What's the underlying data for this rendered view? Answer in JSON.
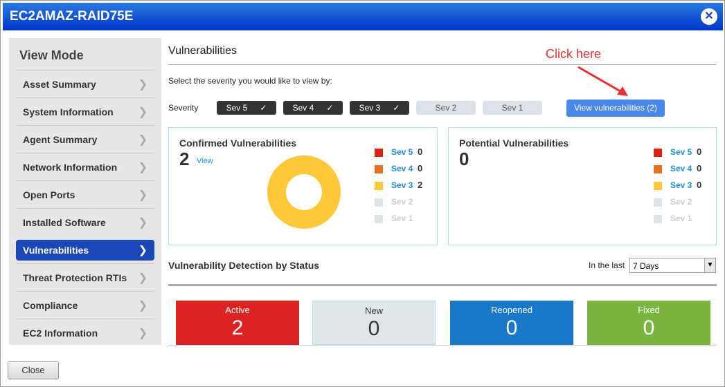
{
  "window": {
    "title": "EC2AMAZ-RAID75E",
    "close_icon": "close-icon"
  },
  "sidebar": {
    "title": "View Mode",
    "items": [
      {
        "label": "Asset Summary"
      },
      {
        "label": "System Information"
      },
      {
        "label": "Agent Summary"
      },
      {
        "label": "Network Information"
      },
      {
        "label": "Open Ports"
      },
      {
        "label": "Installed Software"
      },
      {
        "label": "Vulnerabilities",
        "active": true
      },
      {
        "label": "Threat Protection RTIs"
      },
      {
        "label": "Compliance"
      },
      {
        "label": "EC2 Information"
      }
    ]
  },
  "main": {
    "title": "Vulnerabilities",
    "prompt": "Select the severity you would like to view by:",
    "severity_label": "Severity",
    "severities": [
      {
        "label": "Sev 5",
        "selected": true
      },
      {
        "label": "Sev 4",
        "selected": true
      },
      {
        "label": "Sev 3",
        "selected": true
      },
      {
        "label": "Sev 2",
        "selected": false
      },
      {
        "label": "Sev 1",
        "selected": false
      }
    ],
    "view_button": "View vulnerabilities (2)",
    "annotation": "Click here",
    "confirmed": {
      "title": "Confirmed Vulnerabilities",
      "count": "2",
      "view_link": "View",
      "legend": [
        {
          "label": "Sev 5",
          "count": "0",
          "color": "#e02010"
        },
        {
          "label": "Sev 4",
          "count": "0",
          "color": "#e87020"
        },
        {
          "label": "Sev 3",
          "count": "2",
          "color": "#ffc838"
        },
        {
          "label": "Sev 2",
          "count": "",
          "color": "#dde2e6"
        },
        {
          "label": "Sev 1",
          "count": "",
          "color": "#dde2e6"
        }
      ],
      "donut": {
        "Sev 3": 2
      }
    },
    "potential": {
      "title": "Potential Vulnerabilities",
      "count": "0",
      "legend": [
        {
          "label": "Sev 5",
          "count": "0",
          "color": "#e02010"
        },
        {
          "label": "Sev 4",
          "count": "0",
          "color": "#e87020"
        },
        {
          "label": "Sev 3",
          "count": "0",
          "color": "#ffc838"
        },
        {
          "label": "Sev 2",
          "count": "",
          "color": "#dde2e6"
        },
        {
          "label": "Sev 1",
          "count": "",
          "color": "#dde2e6"
        }
      ]
    },
    "detection": {
      "title": "Vulnerability Detection by Status",
      "range_label": "In the last",
      "range_value": "7 Days",
      "tiles": [
        {
          "label": "Active",
          "value": "2",
          "color": "#dd2222"
        },
        {
          "label": "New",
          "value": "0",
          "color": "#dfe5e9"
        },
        {
          "label": "Reopened",
          "value": "0",
          "color": "#1a78c8"
        },
        {
          "label": "Fixed",
          "value": "0",
          "color": "#7ab540"
        }
      ]
    }
  },
  "footer": {
    "close_button": "Close"
  }
}
